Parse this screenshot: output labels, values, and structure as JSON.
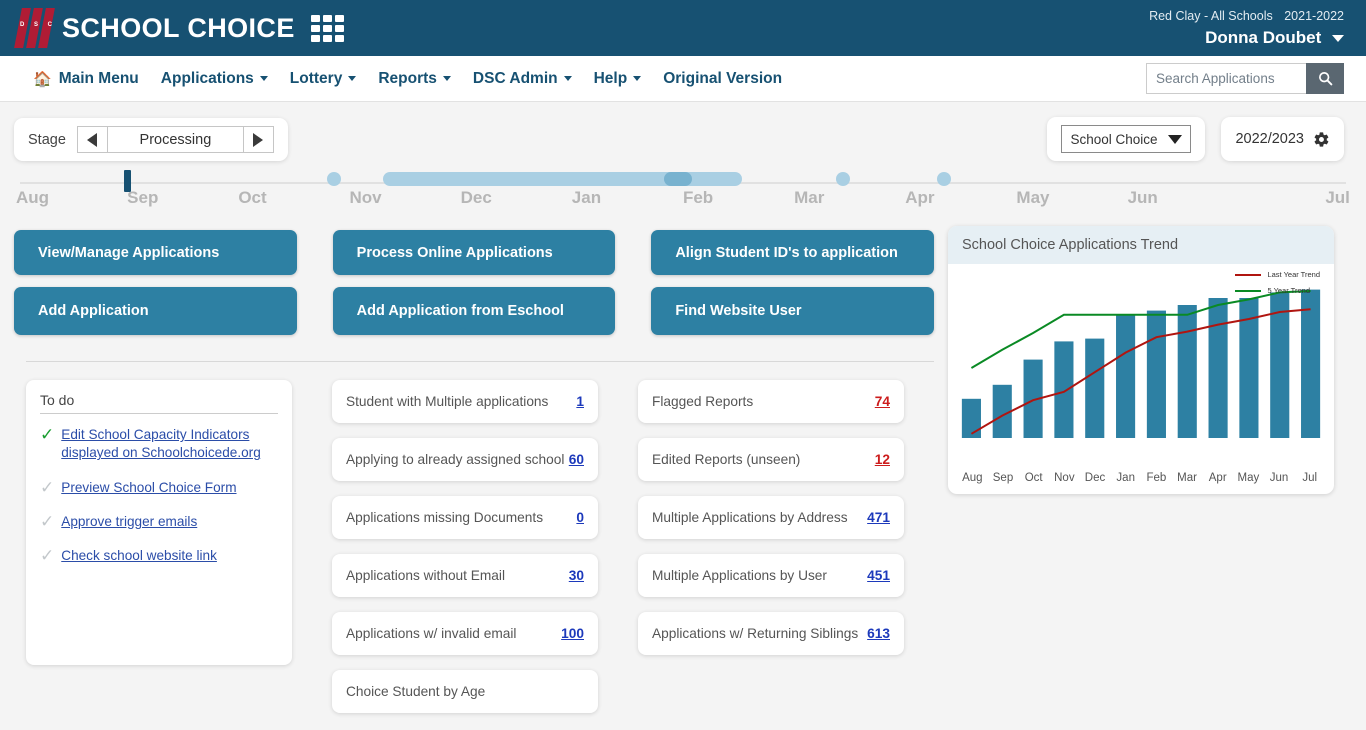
{
  "header": {
    "brand": "SCHOOL CHOICE",
    "logo_letters": [
      "D",
      "S",
      "C"
    ],
    "grid_icon": "apps-grid-icon",
    "org": "Red Clay - All Schools",
    "school_year": "2021-2022",
    "user": "Donna Doubet"
  },
  "nav": {
    "items": [
      {
        "label": "Main Menu",
        "icon": "home-icon",
        "caret": false
      },
      {
        "label": "Applications",
        "icon": "",
        "caret": true
      },
      {
        "label": "Lottery",
        "icon": "",
        "caret": true
      },
      {
        "label": "Reports",
        "icon": "",
        "caret": true
      },
      {
        "label": "DSC Admin",
        "icon": "",
        "caret": true
      },
      {
        "label": "Help",
        "icon": "",
        "caret": true
      },
      {
        "label": "Original Version",
        "icon": "",
        "caret": false
      }
    ],
    "search_placeholder": "Search Applications",
    "search_value": "",
    "search_icon": "search-icon"
  },
  "controls": {
    "stage_label": "Stage",
    "stage_value": "Processing",
    "prev_icon": "chevron-left-icon",
    "next_icon": "chevron-right-icon",
    "program_selected": "School Choice",
    "program_caret": "chevron-down-icon",
    "year_value": "2022/2023",
    "settings_icon": "gear-icon"
  },
  "timeline": {
    "months": [
      "Aug",
      "Sep",
      "Oct",
      "Nov",
      "Dec",
      "Jan",
      "Feb",
      "Mar",
      "Apr",
      "May",
      "Jun",
      "Jul"
    ],
    "current_marker_month": "Aug-Sep",
    "markers": [
      {
        "type": "dot",
        "left_pct": 23.8
      },
      {
        "type": "range",
        "left_pct": 28.4,
        "width_pct": 27.0
      },
      {
        "type": "knob",
        "left_pct": 49.0
      },
      {
        "type": "dot",
        "left_pct": 61.7
      },
      {
        "type": "dot",
        "left_pct": 69.3
      }
    ]
  },
  "actions": [
    {
      "label": "View/Manage Applications"
    },
    {
      "label": "Process Online Applications"
    },
    {
      "label": "Align Student ID's to application"
    },
    {
      "label": "Add Application"
    },
    {
      "label": "Add Application from Eschool"
    },
    {
      "label": "Find Website User"
    }
  ],
  "todo": {
    "title": "To do",
    "items": [
      {
        "label": "Edit School Capacity Indicators displayed on Schoolchoicede.org",
        "state": "done",
        "check_icon": "check-icon"
      },
      {
        "label": "Preview School Choice Form",
        "state": "pending",
        "check_icon": "check-icon"
      },
      {
        "label": "Approve trigger emails",
        "state": "pending",
        "check_icon": "check-icon"
      },
      {
        "label": "Check school website link",
        "state": "pending",
        "check_icon": "check-icon"
      }
    ]
  },
  "stats_middle": [
    {
      "label": "Student with Multiple applications",
      "value": "1",
      "color": "blue"
    },
    {
      "label": "Applying to  already assigned school",
      "value": "60",
      "color": "blue"
    },
    {
      "label": "Applications  missing Documents",
      "value": "0",
      "color": "blue"
    },
    {
      "label": "Applications without Email",
      "value": "30",
      "color": "blue"
    },
    {
      "label": "Applications w/ invalid email",
      "value": "100",
      "color": "blue"
    },
    {
      "label": "Choice Student by Age",
      "value": "",
      "color": "blue"
    }
  ],
  "stats_right": [
    {
      "label": "Flagged Reports",
      "value": "74",
      "color": "red"
    },
    {
      "label": "Edited Reports (unseen)",
      "value": "12",
      "color": "red"
    },
    {
      "label": "Multiple Applications by Address",
      "value": "471",
      "color": "blue"
    },
    {
      "label": "Multiple Applications by User",
      "value": "451",
      "color": "blue"
    },
    {
      "label": "Applications w/ Returning Siblings",
      "value": "613",
      "color": "blue"
    }
  ],
  "chart_data": {
    "type": "bar",
    "title": "School Choice Applications Trend",
    "categories": [
      "Aug",
      "Sep",
      "Oct",
      "Nov",
      "Dec",
      "Jan",
      "Feb",
      "Mar",
      "Apr",
      "May",
      "Jun",
      "Jul"
    ],
    "values": [
      28,
      38,
      56,
      69,
      71,
      88,
      91,
      95,
      100,
      100,
      104,
      106
    ],
    "ylim": [
      0,
      120
    ],
    "xlabel": "",
    "ylabel": "",
    "grid": false,
    "legend_position": "top-right",
    "series": [
      {
        "name": "Last Year Trend",
        "type": "line",
        "color": "#b01510",
        "values": [
          3,
          16,
          27,
          33,
          47,
          61,
          72,
          76,
          81,
          85,
          90,
          92
        ]
      },
      {
        "name": "5 Year Trend",
        "type": "line",
        "color": "#0a8a24",
        "values": [
          50,
          63,
          75,
          88,
          88,
          88,
          88,
          88,
          95,
          99,
          104,
          105
        ]
      }
    ]
  }
}
